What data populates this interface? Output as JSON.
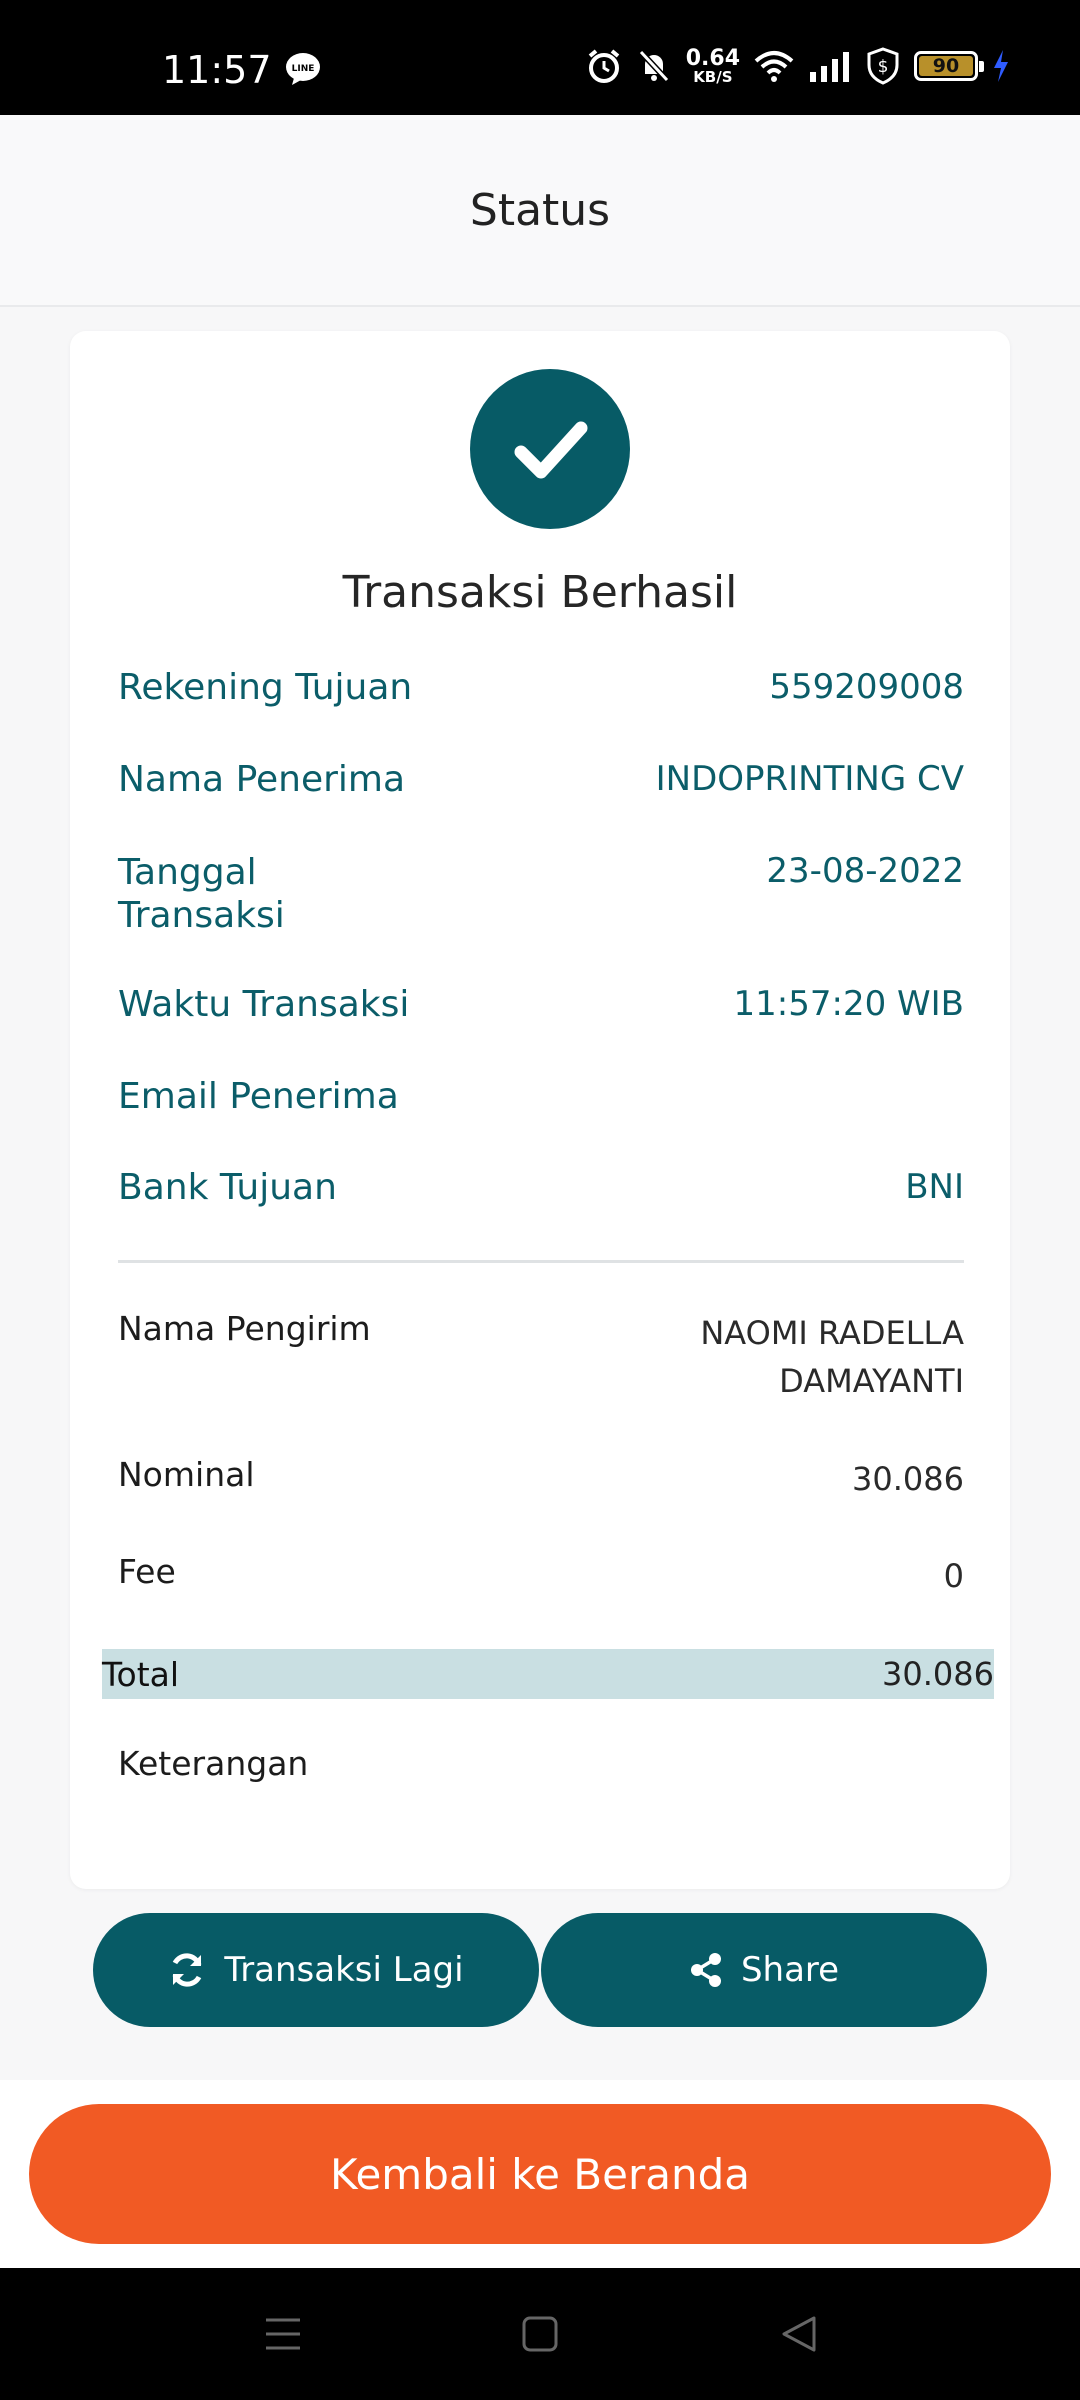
{
  "status_bar": {
    "time": "11:57",
    "net_speed_value": "0.64",
    "net_speed_unit": "KB/S",
    "battery": "90"
  },
  "header": {
    "title": "Status"
  },
  "card": {
    "status_title": "Transaksi Berhasil",
    "recipient_details": [
      {
        "label": "Rekening Tujuan",
        "value": "559209008"
      },
      {
        "label": "Nama Penerima",
        "value": "INDOPRINTING CV"
      },
      {
        "label": "Tanggal Transaksi",
        "value": "23-08-2022"
      },
      {
        "label": "Waktu Transaksi",
        "value": "11:57:20 WIB"
      },
      {
        "label": "Email Penerima",
        "value": ""
      },
      {
        "label": "Bank Tujuan",
        "value": "BNI"
      }
    ],
    "sender_details": [
      {
        "label": "Nama Pengirim",
        "value": "NAOMI RADELLA DAMAYANTI"
      },
      {
        "label": "Nominal",
        "value": "30.086"
      },
      {
        "label": "Fee",
        "value": "0"
      }
    ],
    "total": {
      "label": "Total",
      "value": "30.086"
    },
    "note_label": "Keterangan"
  },
  "actions": {
    "again_label": "Transaksi Lagi",
    "share_label": "Share",
    "home_label": "Kembali ke Beranda"
  },
  "colors": {
    "primary": "#075b66",
    "accent": "#f15a24",
    "total_highlight": "#c9dfe2"
  }
}
